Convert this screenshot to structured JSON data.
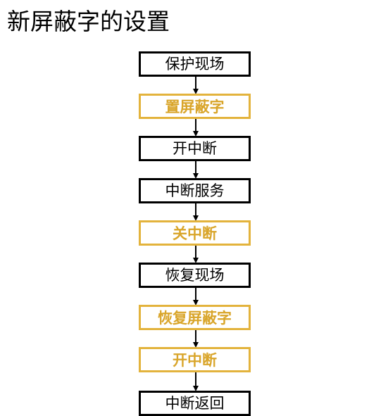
{
  "title": "新屏蔽字的设置",
  "colors": {
    "normal_border": "#000000",
    "normal_text": "#000000",
    "highlight_border": "#e3b33c",
    "highlight_text": "#d9a52a",
    "arrow": "#000000"
  },
  "steps": [
    {
      "label": "保护现场",
      "highlight": false
    },
    {
      "label": "置屏蔽字",
      "highlight": true
    },
    {
      "label": "开中断",
      "highlight": false
    },
    {
      "label": "中断服务",
      "highlight": false
    },
    {
      "label": "关中断",
      "highlight": true
    },
    {
      "label": "恢复现场",
      "highlight": false
    },
    {
      "label": "恢复屏蔽字",
      "highlight": true
    },
    {
      "label": "开中断",
      "highlight": true
    },
    {
      "label": "中断返回",
      "highlight": false
    }
  ]
}
